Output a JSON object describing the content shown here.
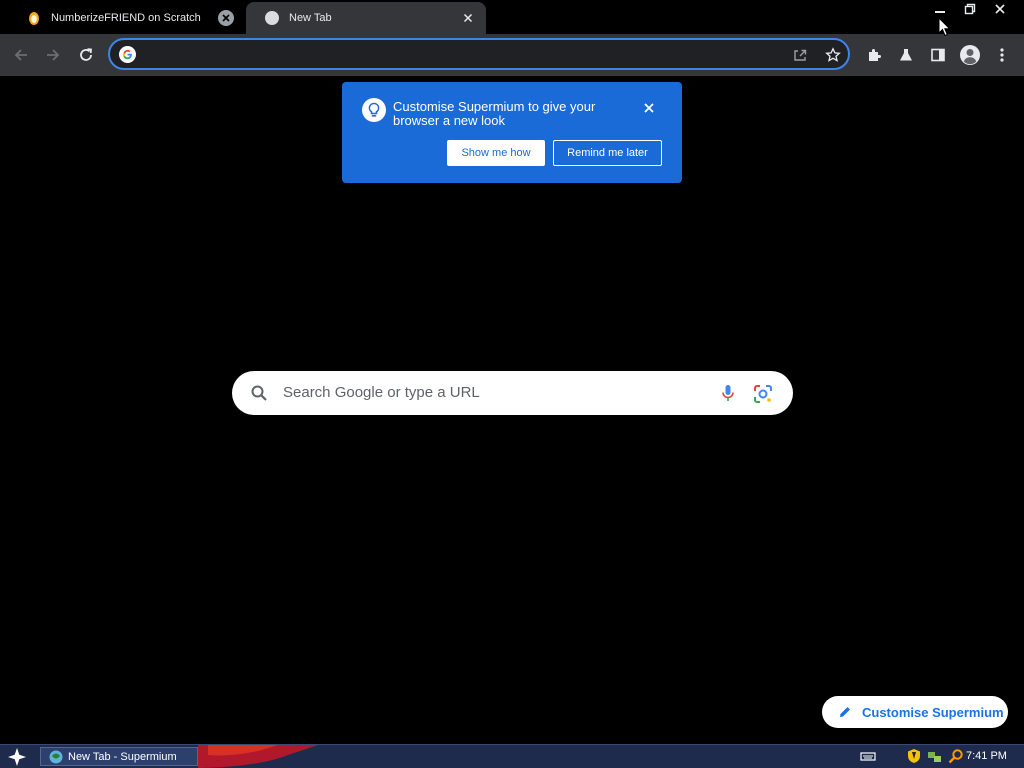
{
  "tabs": [
    {
      "title": "NumberizeFRIEND on Scratch",
      "favicon": "scratch-cat-icon",
      "active": false
    },
    {
      "title": "New Tab",
      "favicon": "globe-icon",
      "active": true
    }
  ],
  "toolbar": {
    "address_value": "",
    "icons": [
      "back-icon",
      "forward-icon",
      "reload-icon",
      "share-icon",
      "bookmark-star-icon",
      "extensions-icon",
      "labs-flask-icon",
      "side-panel-icon",
      "profile-icon",
      "menu-icon"
    ]
  },
  "promo": {
    "text": "Customise Supermium to give your browser a new look",
    "primary_button": "Show me how",
    "secondary_button": "Remind me later"
  },
  "search": {
    "placeholder": "Search Google or type a URL"
  },
  "customise_button": {
    "label": "Customise Supermium"
  },
  "taskbar": {
    "task_label": "New Tab - Supermium",
    "clock": "7:41 PM"
  },
  "colors": {
    "accent": "#1a6ad8",
    "omnibox_border": "#3d86e8",
    "toolbar": "#35363a",
    "taskbar": "#1e2b4d"
  }
}
